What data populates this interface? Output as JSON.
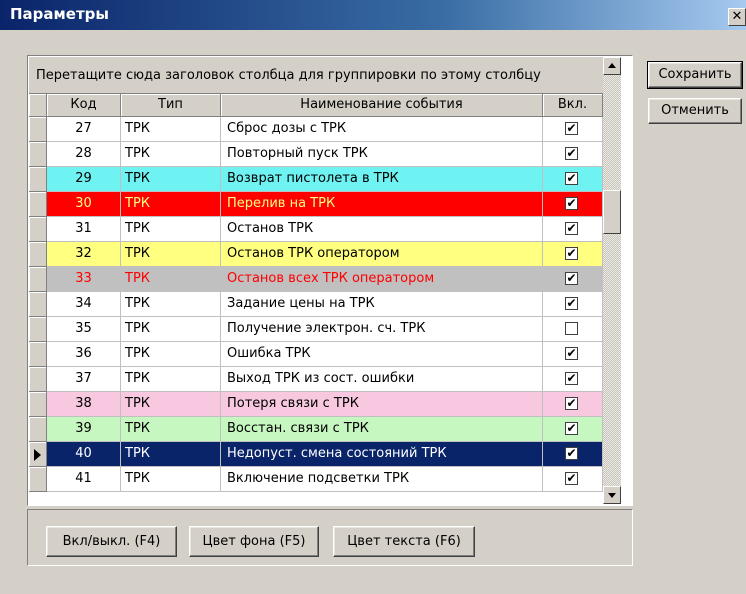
{
  "window": {
    "title": "Параметры",
    "close_glyph": "✕"
  },
  "actions": {
    "save_label": "Сохранить",
    "cancel_label": "Отменить"
  },
  "grid": {
    "group_hint": "Перетащите сюда заголовок столбца для группировки по этому столбцу",
    "columns": {
      "code": "Код",
      "type": "Тип",
      "name": "Наименование события",
      "enabled": "Вкл."
    },
    "current_row_index": 13,
    "rows": [
      {
        "code": "27",
        "type": "ТРК",
        "name": "Сброс дозы с ТРК",
        "enabled": true,
        "bg": "#ffffff",
        "fg": "#000000"
      },
      {
        "code": "28",
        "type": "ТРК",
        "name": "Повторный пуск ТРК",
        "enabled": true,
        "bg": "#ffffff",
        "fg": "#000000"
      },
      {
        "code": "29",
        "type": "ТРК",
        "name": "Возврат пистолета в ТРК",
        "enabled": true,
        "bg": "#6ff2f2",
        "fg": "#000000"
      },
      {
        "code": "30",
        "type": "ТРК",
        "name": "Перелив на ТРК",
        "enabled": true,
        "bg": "#ff0000",
        "fg": "#ffff80"
      },
      {
        "code": "31",
        "type": "ТРК",
        "name": "Останов ТРК",
        "enabled": true,
        "bg": "#ffffff",
        "fg": "#000000"
      },
      {
        "code": "32",
        "type": "ТРК",
        "name": "Останов ТРК оператором",
        "enabled": true,
        "bg": "#ffff80",
        "fg": "#000000"
      },
      {
        "code": "33",
        "type": "ТРК",
        "name": "Останов всех ТРК оператором",
        "enabled": true,
        "bg": "#c0c0c0",
        "fg": "#ff0000"
      },
      {
        "code": "34",
        "type": "ТРК",
        "name": "Задание цены на ТРК",
        "enabled": true,
        "bg": "#ffffff",
        "fg": "#000000"
      },
      {
        "code": "35",
        "type": "ТРК",
        "name": "Получение электрон. сч. ТРК",
        "enabled": false,
        "bg": "#ffffff",
        "fg": "#000000"
      },
      {
        "code": "36",
        "type": "ТРК",
        "name": "Ошибка ТРК",
        "enabled": true,
        "bg": "#ffffff",
        "fg": "#000000"
      },
      {
        "code": "37",
        "type": "ТРК",
        "name": "Выход ТРК из сост. ошибки",
        "enabled": true,
        "bg": "#ffffff",
        "fg": "#000000"
      },
      {
        "code": "38",
        "type": "ТРК",
        "name": "Потеря связи с ТРК",
        "enabled": true,
        "bg": "#f7c8e0",
        "fg": "#000000"
      },
      {
        "code": "39",
        "type": "ТРК",
        "name": "Восстан. связи с ТРК",
        "enabled": true,
        "bg": "#c6f7c0",
        "fg": "#000000"
      },
      {
        "code": "40",
        "type": "ТРК",
        "name": "Недопуст. смена состояний ТРК",
        "enabled": true,
        "bg": "#0a246a",
        "fg": "#ffffff"
      },
      {
        "code": "41",
        "type": "ТРК",
        "name": "Включение подсветки ТРК",
        "enabled": true,
        "bg": "#ffffff",
        "fg": "#000000"
      }
    ]
  },
  "bottom_buttons": {
    "toggle_label": "Вкл/выкл. (F4)",
    "bg_color_label": "Цвет фона (F5)",
    "text_color_label": "Цвет текста (F6)"
  },
  "icons": {
    "checkmark": "✔",
    "row_pointer": "triangle-right",
    "scroll_up": "triangle-up",
    "scroll_down": "triangle-down"
  }
}
